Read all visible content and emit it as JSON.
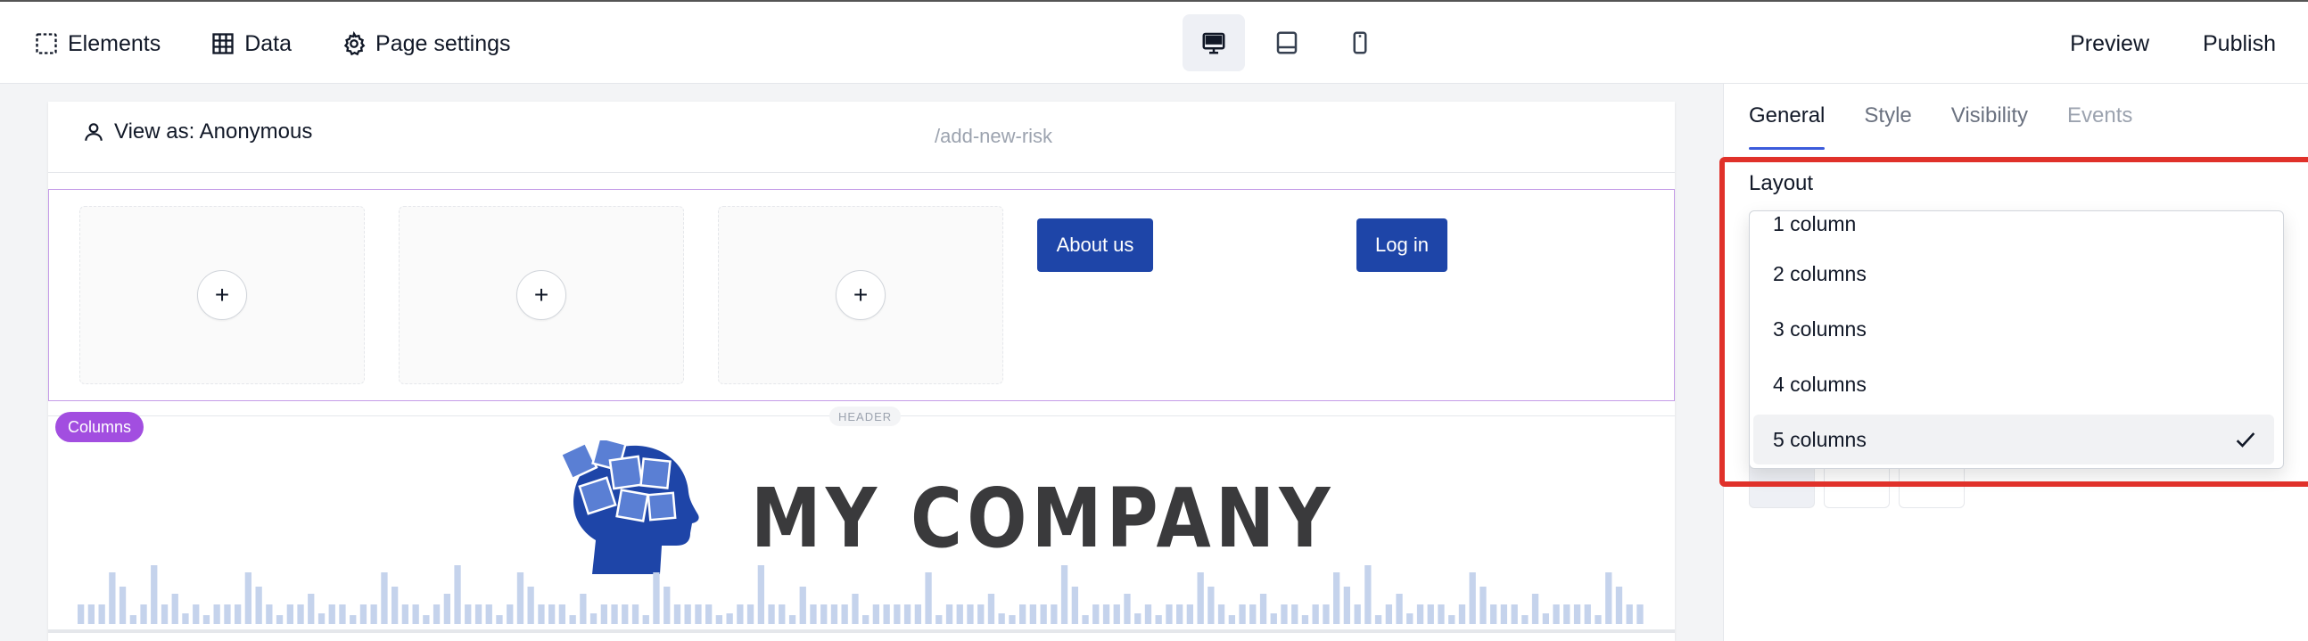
{
  "toolbar": {
    "elements_label": "Elements",
    "data_label": "Data",
    "page_settings_label": "Page settings",
    "devices": [
      "desktop-icon",
      "tablet-icon",
      "mobile-icon"
    ],
    "preview_label": "Preview",
    "publish_label": "Publish"
  },
  "canvas": {
    "view_as": "View as: Anonymous",
    "route": "/add-new-risk",
    "about_button": "About us",
    "login_button": "Log in",
    "columns_tag": "Columns",
    "header_tag": "HEADER",
    "logo_text": "MY COMPANY",
    "accent_color": "#1e45a8"
  },
  "panel": {
    "tabs": [
      "General",
      "Style",
      "Visibility",
      "Events"
    ],
    "layout_label": "Layout",
    "layout_options": [
      "1 column",
      "2 columns",
      "3 columns",
      "4 columns",
      "5 columns"
    ],
    "selected_option": "5 columns"
  }
}
